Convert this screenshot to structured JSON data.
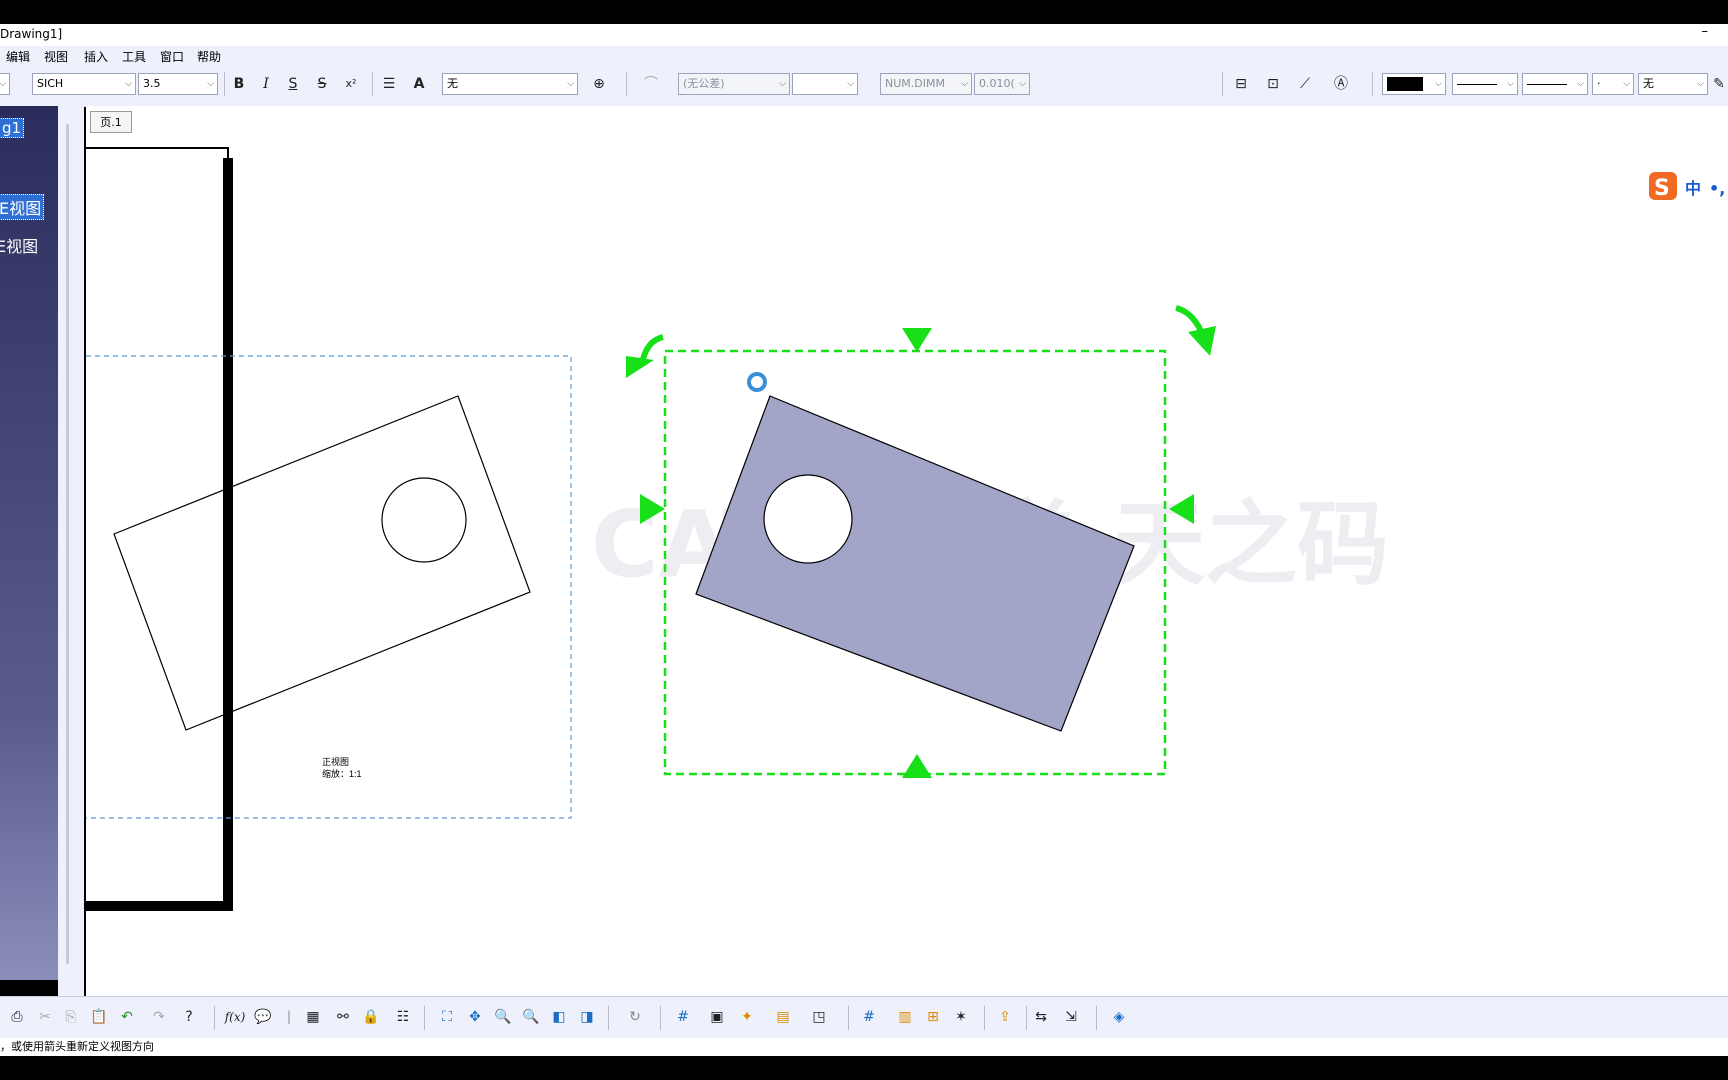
{
  "window": {
    "title": "Drawing1]",
    "minimize_glyph": "–"
  },
  "menu": [
    "编辑",
    "视图",
    "插入",
    "工具",
    "窗口",
    "帮助"
  ],
  "toolbar": {
    "font_name": "SICH",
    "font_size": "3.5",
    "frame_value": "无",
    "tolerance": "(无公差)",
    "tolerance_format": "",
    "num_format": "NUM.DIMM",
    "precision": "0.010(",
    "line_end": "无",
    "bold": "B",
    "italic": "I",
    "underline": "S",
    "strike": "S",
    "superscript": "x²",
    "text_color": "A",
    "icons": [
      "anchor-icon",
      "align-icon",
      "insert-text-icon",
      "dimension-icon",
      "fill-color-icon"
    ]
  },
  "tree": {
    "root": "g1",
    "items": [
      "E视图",
      "E视图"
    ]
  },
  "sheet": {
    "tab": "页.1"
  },
  "view_label": {
    "name": "正视图",
    "scale": "缩放：1:1"
  },
  "watermark": "CATIA教学-天之码",
  "ime": {
    "label": "中"
  },
  "bottom_toolbar": {
    "icons": [
      "print-icon",
      "cut-icon",
      "copy-icon",
      "paste-icon",
      "undo-icon",
      "redo-icon",
      "whats-this-icon",
      "formula-icon",
      "comment-icon",
      "knowledge-icon",
      "table-icon",
      "tree-icon",
      "lock-icon",
      "catalog-icon",
      "fit-all-icon",
      "pan-icon",
      "zoom-in-icon",
      "zoom-out-icon",
      "normal-view-icon",
      "multi-view-icon",
      "update-icon",
      "grid-icon",
      "sheet-icon",
      "frame-icon",
      "title-block-icon",
      "detail-icon",
      "grid-2-icon",
      "view-box-icon",
      "view-star-icon",
      "export-icon",
      "swap-icon",
      "move-icon",
      "layer-icon"
    ]
  },
  "status": "，或使用箭头重新定义视图方向",
  "colors": {
    "handle_green": "#18e018",
    "shape_fill": "#a2a5c8",
    "frame_blue": "#5b9bd5"
  }
}
